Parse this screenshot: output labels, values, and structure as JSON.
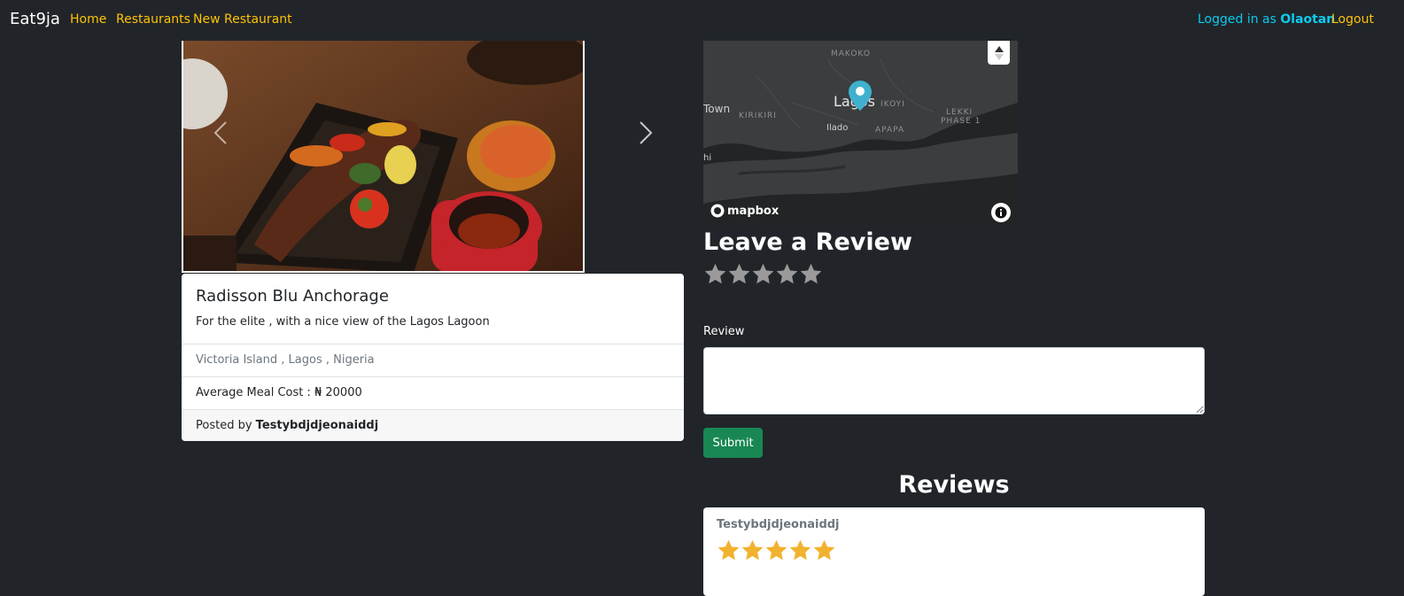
{
  "navbar": {
    "brand": "Eat9ja",
    "links": [
      "Home",
      "Restaurants",
      "New Restaurant"
    ],
    "logged_in_prefix": "Logged in as ",
    "username": "Olaotan",
    "logout": "Logout",
    "link_color": "#ffc107",
    "info_color": "#0dcaf0"
  },
  "restaurant": {
    "title": "Radisson Blu Anchorage",
    "description": "For the elite , with a nice view of the Lagos Lagoon",
    "location": "Victoria Island , Lagos , Nigeria",
    "avg_cost": "Average Meal Cost : ₦ 20000",
    "posted_by_prefix": "Posted by ",
    "author": "Testybdjdjeonaiddj"
  },
  "map": {
    "labels": {
      "makoko": "MAKOKO",
      "town": "Town",
      "kirikiri": "KIRIKIRI",
      "lagos": "Lagos",
      "ikoyi": "IKOYI",
      "lekki": "LEKKI",
      "phase": "PHASE 1",
      "ilado": "Ilado",
      "apapa": "APAPA",
      "hi": "hi"
    },
    "attribution": "mapbox",
    "marker_color": "#3fb1ce"
  },
  "review_form": {
    "heading": "Leave a Review",
    "rating": 0,
    "max_rating": 5,
    "label": "Review",
    "value": "",
    "submit": "Submit",
    "submit_color": "#198754"
  },
  "reviews": {
    "heading": "Reviews",
    "items": [
      {
        "author": "Testybdjdjeonaiddj",
        "rating": 5
      }
    ],
    "star_color": "#f1b22e"
  }
}
